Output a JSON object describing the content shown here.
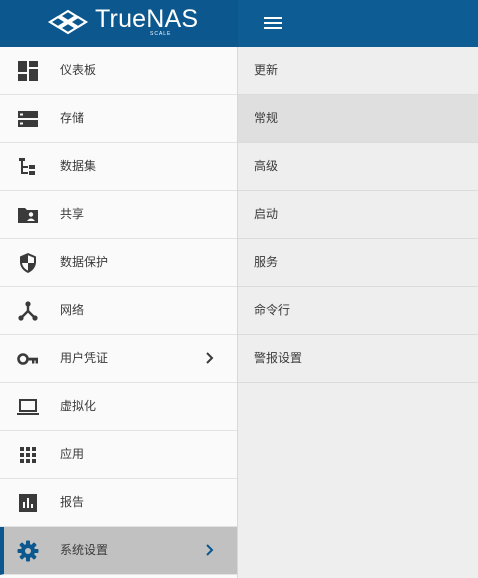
{
  "brand": {
    "name": "TrueNAS",
    "edition": "SCALE"
  },
  "colors": {
    "header": "#0d5d94",
    "brand_bg": "#0b578e",
    "accent": "#0b578e",
    "icon": "#3a3a3a",
    "active_item": "#c1c1c1"
  },
  "sidebar": {
    "items": [
      {
        "label": "仪表板",
        "icon": "dashboard-icon"
      },
      {
        "label": "存储",
        "icon": "storage-icon"
      },
      {
        "label": "数据集",
        "icon": "datasets-icon"
      },
      {
        "label": "共享",
        "icon": "folder-share-icon"
      },
      {
        "label": "数据保护",
        "icon": "security-shield-icon"
      },
      {
        "label": "网络",
        "icon": "network-icon"
      },
      {
        "label": "用户凭证",
        "icon": "key-icon",
        "has_submenu": true
      },
      {
        "label": "虚拟化",
        "icon": "laptop-icon"
      },
      {
        "label": "应用",
        "icon": "apps-grid-icon"
      },
      {
        "label": "报告",
        "icon": "bar-chart-icon"
      },
      {
        "label": "系统设置",
        "icon": "gear-icon",
        "has_submenu": true,
        "active": true
      }
    ]
  },
  "submenu": {
    "items": [
      {
        "label": "更新"
      },
      {
        "label": "常规",
        "active": true
      },
      {
        "label": "高级"
      },
      {
        "label": "启动"
      },
      {
        "label": "服务"
      },
      {
        "label": "命令行"
      },
      {
        "label": "警报设置"
      }
    ]
  }
}
